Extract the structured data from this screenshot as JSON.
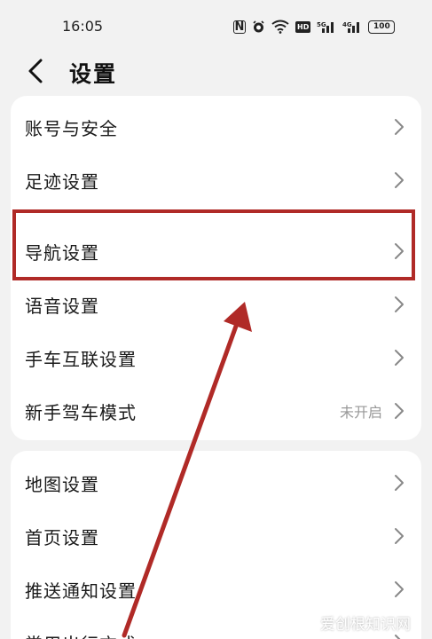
{
  "status_bar": {
    "time": "16:05",
    "battery": "100",
    "hd_label": "HD",
    "nfc_label": "N",
    "signal_label": "5G"
  },
  "header": {
    "title": "设置",
    "back_icon": "chevron-left-icon"
  },
  "group1": [
    {
      "label": "账号与安全",
      "value": ""
    },
    {
      "label": "足迹设置",
      "value": ""
    },
    {
      "label": "导航设置",
      "value": ""
    },
    {
      "label": "语音设置",
      "value": ""
    },
    {
      "label": "手车互联设置",
      "value": ""
    },
    {
      "label": "新手驾车模式",
      "value": "未开启"
    }
  ],
  "group2": [
    {
      "label": "地图设置",
      "value": ""
    },
    {
      "label": "首页设置",
      "value": ""
    },
    {
      "label": "推送通知设置",
      "value": ""
    },
    {
      "label": "常用出行方式",
      "value": ""
    }
  ],
  "annotation": {
    "highlight_color": "#b02a27",
    "arrow_color": "#b02a27"
  },
  "watermark": "爱创根知识网"
}
